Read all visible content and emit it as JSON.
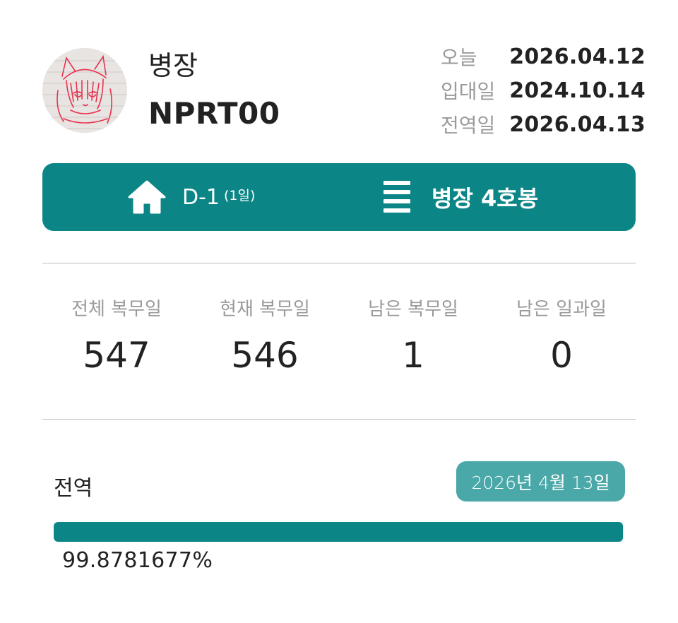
{
  "profile": {
    "rank": "병장",
    "name": "NPRT00",
    "avatar_icon": "avatar-sketch-image"
  },
  "dates": [
    {
      "label": "오늘",
      "value": "2026.04.12"
    },
    {
      "label": "입대일",
      "value": "2024.10.14"
    },
    {
      "label": "전역일",
      "value": "2026.04.13"
    }
  ],
  "status": {
    "dday": "D-1",
    "dday_sub": "(1일)",
    "rank_step": "병장 4호봉",
    "home_icon": "home-icon",
    "menu_icon": "menu-lines-icon",
    "color": "#0b8586"
  },
  "stats": [
    {
      "label": "전체 복무일",
      "value": "547"
    },
    {
      "label": "현재 복무일",
      "value": "546"
    },
    {
      "label": "남은 복무일",
      "value": "1"
    },
    {
      "label": "남은 일과일",
      "value": "0"
    }
  ],
  "progress": {
    "label": "전역",
    "date_chip": "2026년 4월 13일",
    "percent_text": "99.8781677%",
    "fraction": 0.998781677,
    "fill_color": "#0b8586",
    "chip_color": "#4aa8a8"
  }
}
